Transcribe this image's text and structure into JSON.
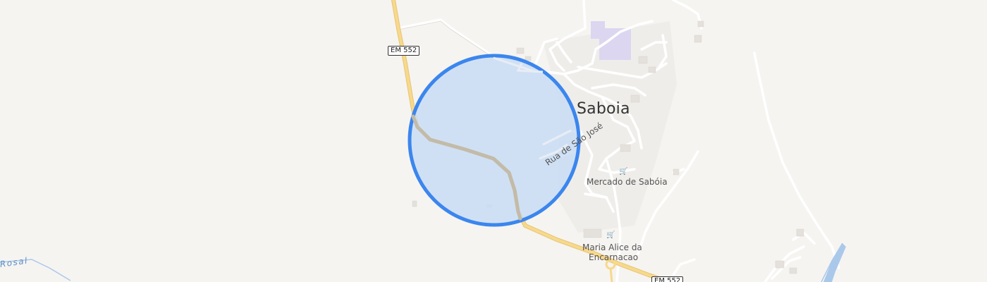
{
  "map": {
    "place_label": "Saboia",
    "road_shields": [
      "EM 552",
      "EM 552"
    ],
    "street_label": "Rua de São José",
    "pois": [
      {
        "name": "Mercado de Sabóia",
        "icon": "shopping-cart-icon"
      },
      {
        "name_line1": "Maria Alice da",
        "name_line2": "Encarnacao",
        "icon": "shopping-cart-icon"
      }
    ],
    "water_label": "Rosal",
    "selection": {
      "shape": "circle",
      "fill": "#c9dcf5",
      "stroke": "#3b86ee"
    }
  },
  "colors": {
    "background": "#f6f4f1",
    "main_road": "#f7d98c",
    "minor_road": "#ffffff",
    "water": "#aac8ea",
    "urban_area": "#efedea",
    "school_area": "#dcd6f0"
  }
}
